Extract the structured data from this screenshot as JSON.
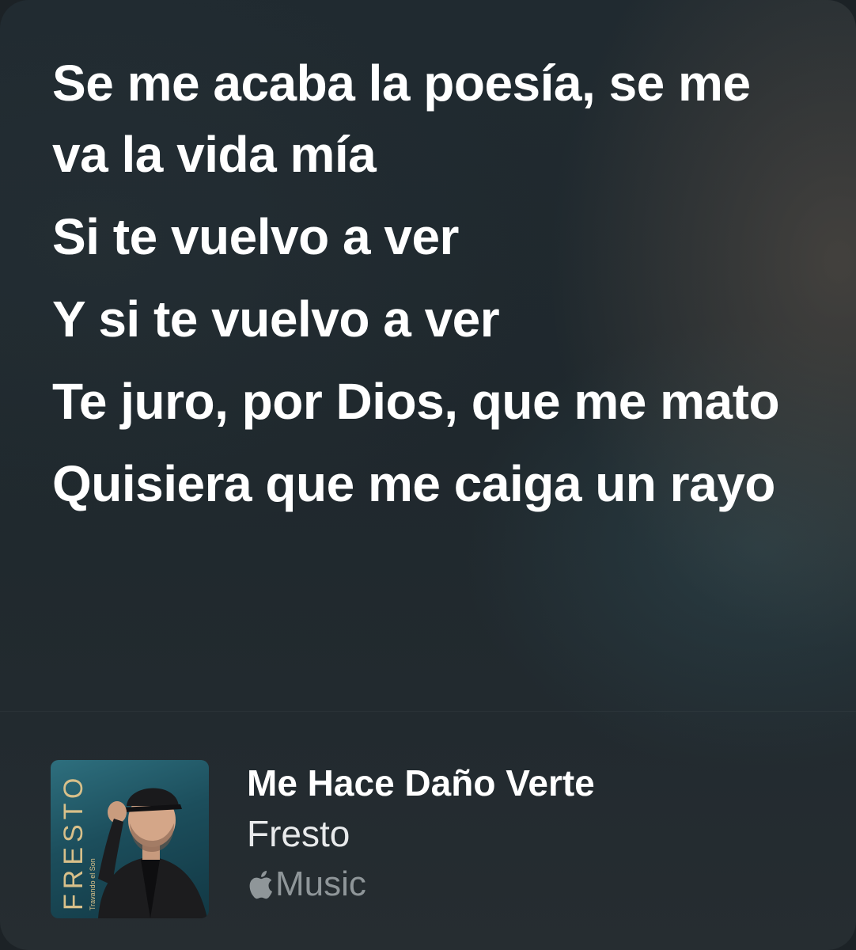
{
  "lyrics": [
    "Se me acaba la poesía, se me va la vida mía",
    "Si te vuelvo a ver",
    "Y si te vuelvo a ver",
    "Te juro, por Dios, que me mato",
    "Quisiera que me caiga un rayo"
  ],
  "now_playing": {
    "song_title": "Me Hace Daño Verte",
    "artist": "Fresto",
    "service_label": "Music",
    "artwork": {
      "title": "FRESTO",
      "subtitle": "Travando el Son"
    }
  },
  "colors": {
    "text_primary": "#ffffff",
    "text_secondary": "#8f9699",
    "artwork_teal": "#1c4e5c",
    "artwork_gold": "#d8c08a"
  }
}
